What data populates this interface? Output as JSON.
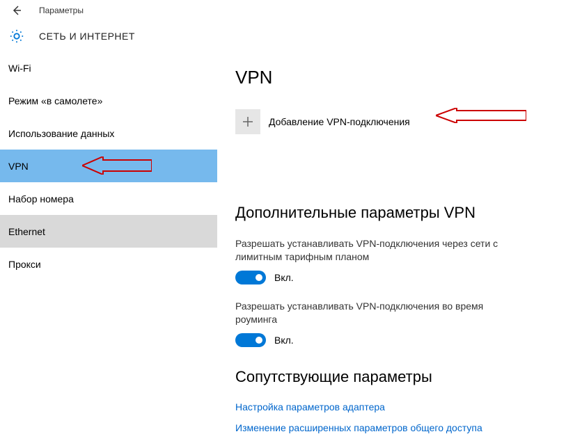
{
  "window": {
    "title": "Параметры"
  },
  "header": {
    "title": "СЕТЬ И ИНТЕРНЕТ"
  },
  "sidebar": {
    "items": [
      {
        "label": "Wi-Fi"
      },
      {
        "label": "Режим «в самолете»"
      },
      {
        "label": "Использование данных"
      },
      {
        "label": "VPN"
      },
      {
        "label": "Набор номера"
      },
      {
        "label": "Ethernet"
      },
      {
        "label": "Прокси"
      }
    ]
  },
  "content": {
    "page_title": "VPN",
    "add_label": "Добавление VPN-подключения",
    "advanced_title": "Дополнительные параметры VPN",
    "setting1_desc": "Разрешать устанавливать VPN-подключения через сети с лимитным тарифным планом",
    "setting1_state": "Вкл.",
    "setting2_desc": "Разрешать устанавливать VPN-подключения во время роуминга",
    "setting2_state": "Вкл.",
    "related_title": "Сопутствующие параметры",
    "link1": "Настройка параметров адаптера",
    "link2": "Изменение расширенных параметров общего доступа"
  }
}
